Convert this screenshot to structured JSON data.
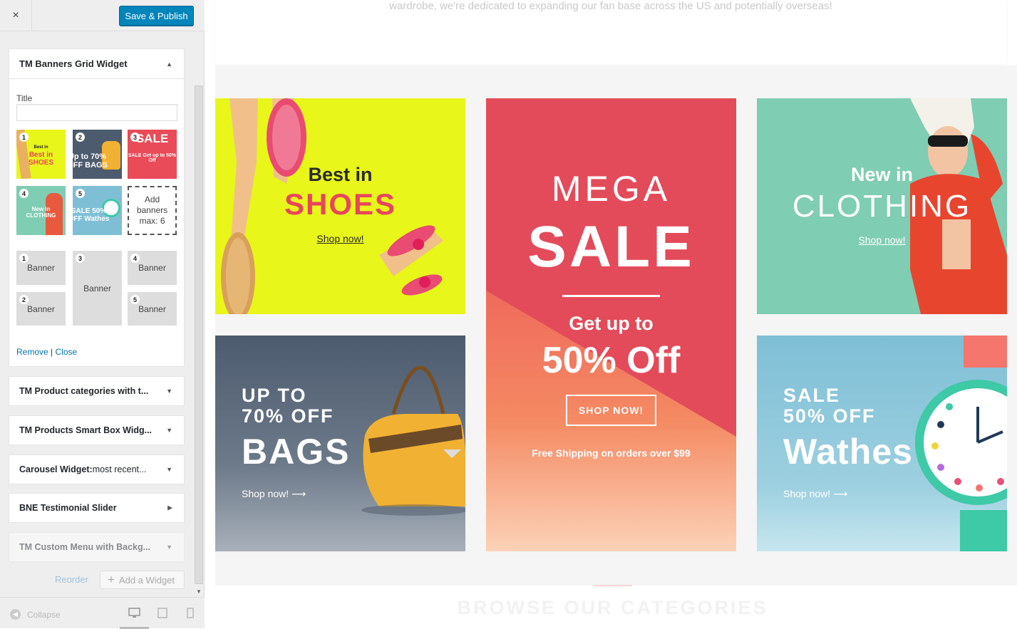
{
  "sidebar": {
    "close_label": "×",
    "publish_label": "Save & Publish",
    "open_widget": {
      "title": "TM Banners Grid Widget",
      "title_field_label": "Title",
      "title_field_value": "",
      "thumbnails": [
        {
          "num": "1",
          "text": "Best in SHOES"
        },
        {
          "num": "2",
          "text": "Up to 70% OFF BAGS"
        },
        {
          "num": "3",
          "text": "SALE Get up to 50% Off"
        },
        {
          "num": "4",
          "text": "New in CLOTHING"
        },
        {
          "num": "5",
          "text": "SALE 50% OFF Wathes"
        }
      ],
      "add_banner_label": "Add banners max: 6",
      "slots": [
        {
          "num": "1",
          "label": "Banner"
        },
        {
          "num": "3",
          "label": "Banner"
        },
        {
          "num": "4",
          "label": "Banner"
        },
        {
          "num": "2",
          "label": "Banner"
        },
        {
          "num": "5",
          "label": "Banner"
        }
      ],
      "remove_label": "Remove",
      "separator": "|",
      "close_link_label": "Close"
    },
    "widgets": [
      {
        "bold": "TM Product categories with t...",
        "rest": ""
      },
      {
        "bold": "TM Products Smart Box Widg...",
        "rest": ""
      },
      {
        "bold": "Carousel Widget:",
        "rest": " most recent..."
      },
      {
        "bold": "BNE Testimonial Slider",
        "rest": ""
      },
      {
        "bold": "TM Custom Menu with Backg...",
        "rest": ""
      }
    ],
    "reorder_label": "Reorder",
    "add_widget_label": "Add a Widget",
    "collapse_label": "Collapse",
    "devices": [
      "desktop-icon",
      "tablet-icon",
      "mobile-icon"
    ]
  },
  "preview": {
    "intro_text": "wardrobe, we're dedicated to expanding our fan base across the US and potentially overseas!",
    "banners": {
      "shoes": {
        "line1": "Best in",
        "line2": "SHOES",
        "cta": "Shop now!"
      },
      "bags": {
        "line1": "UP TO",
        "line2": "70% OFF",
        "line3": "BAGS",
        "cta": "Shop now!"
      },
      "sale": {
        "line1": "MEGA",
        "line2": "SALE",
        "line3": "Get up to",
        "line4": "50% Off",
        "cta": "SHOP NOW!",
        "note": "Free Shipping on orders over $99"
      },
      "clothing": {
        "line1": "New in",
        "line2": "CLOTHING",
        "cta": "Shop now!"
      },
      "watches": {
        "line1": "SALE",
        "line2": "50% OFF",
        "line3": "Wathes",
        "cta": "Shop now!"
      }
    },
    "browse_heading": "BROWSE OUR CATEGORIES"
  },
  "colors": {
    "publish_blue": "#0085ba",
    "link_blue": "#0073aa",
    "shoes_bg": "#e8f61a",
    "shoes_accent": "#e8455b",
    "sale_red": "#e34b5a",
    "clothing_bg": "#7fcdb3",
    "watch_bg": "#7fbfd6"
  }
}
